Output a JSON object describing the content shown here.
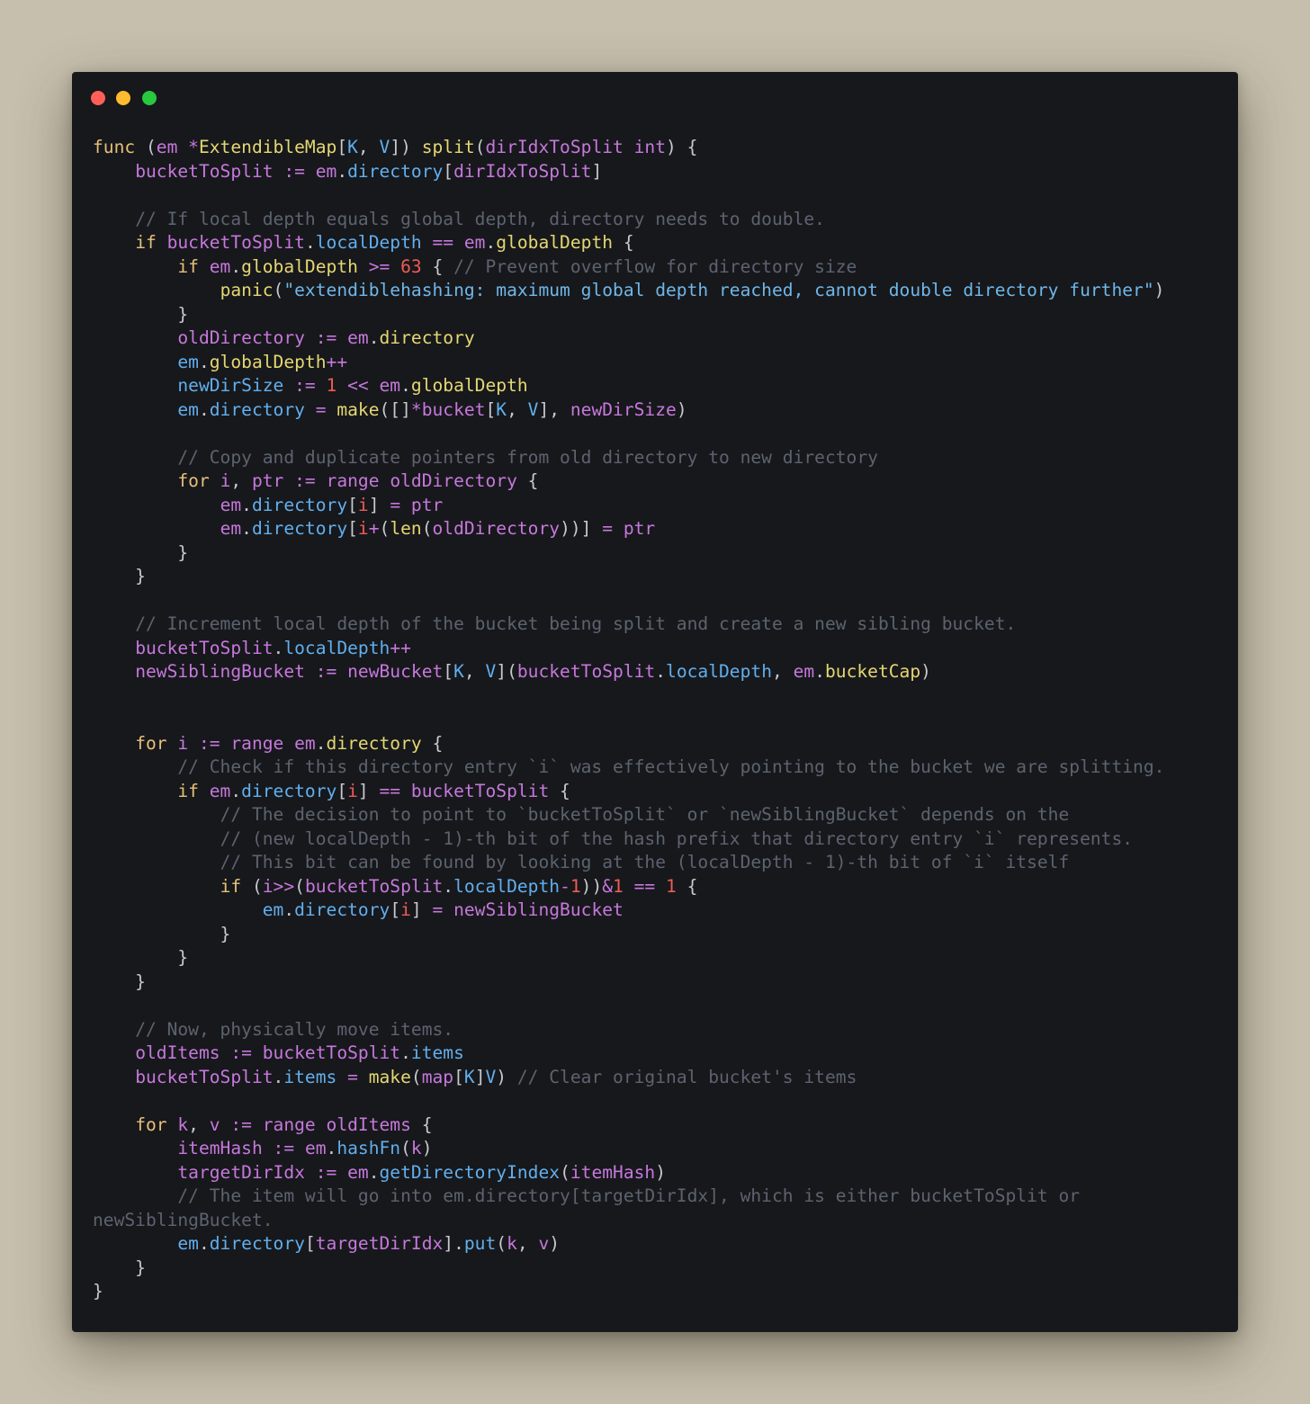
{
  "window": {
    "controls": [
      "close",
      "minimize",
      "zoom"
    ],
    "colors": {
      "background": "#17181b",
      "page": "#c6bfad",
      "close": "#ff5f57",
      "minimize": "#febc2e",
      "zoom": "#28c840"
    }
  },
  "code": {
    "language": "Go",
    "lines": [
      [
        [
          "kw",
          "func"
        ],
        [
          "p",
          " ("
        ],
        [
          "var",
          "em"
        ],
        [
          "p",
          " "
        ],
        [
          "op",
          "*"
        ],
        [
          "fn",
          "ExtendibleMap"
        ],
        [
          "p",
          "["
        ],
        [
          "typ",
          "K"
        ],
        [
          "p",
          ", "
        ],
        [
          "typ",
          "V"
        ],
        [
          "p",
          "]) "
        ],
        [
          "fn",
          "split"
        ],
        [
          "p",
          "("
        ],
        [
          "var",
          "dirIdxToSplit"
        ],
        [
          "p",
          " "
        ],
        [
          "var",
          "int"
        ],
        [
          "p",
          ") {"
        ]
      ],
      [
        [
          "p",
          "    "
        ],
        [
          "var",
          "bucketToSplit"
        ],
        [
          "p",
          " "
        ],
        [
          "op",
          ":="
        ],
        [
          "p",
          " "
        ],
        [
          "var",
          "em"
        ],
        [
          "p",
          "."
        ],
        [
          "field",
          "directory"
        ],
        [
          "p",
          "["
        ],
        [
          "var",
          "dirIdxToSplit"
        ],
        [
          "p",
          "]"
        ]
      ],
      [],
      [
        [
          "p",
          "    "
        ],
        [
          "com",
          "// If local depth equals global depth, directory needs to double."
        ]
      ],
      [
        [
          "p",
          "    "
        ],
        [
          "kw",
          "if"
        ],
        [
          "p",
          " "
        ],
        [
          "var",
          "bucketToSplit"
        ],
        [
          "p",
          "."
        ],
        [
          "field",
          "localDepth"
        ],
        [
          "p",
          " "
        ],
        [
          "op",
          "=="
        ],
        [
          "p",
          " "
        ],
        [
          "var",
          "em"
        ],
        [
          "p",
          "."
        ],
        [
          "fn",
          "globalDepth"
        ],
        [
          "p",
          " {"
        ]
      ],
      [
        [
          "p",
          "        "
        ],
        [
          "kw",
          "if"
        ],
        [
          "p",
          " "
        ],
        [
          "var",
          "em"
        ],
        [
          "p",
          "."
        ],
        [
          "fn",
          "globalDepth"
        ],
        [
          "p",
          " "
        ],
        [
          "op",
          ">="
        ],
        [
          "p",
          " "
        ],
        [
          "num",
          "63"
        ],
        [
          "p",
          " { "
        ],
        [
          "com",
          "// Prevent overflow for directory size"
        ]
      ],
      [
        [
          "p",
          "            "
        ],
        [
          "fn",
          "panic"
        ],
        [
          "p",
          "("
        ],
        [
          "str",
          "\"extendiblehashing: maximum global depth reached, cannot double directory further\""
        ],
        [
          "p",
          ")"
        ]
      ],
      [
        [
          "p",
          "        }"
        ]
      ],
      [
        [
          "p",
          "        "
        ],
        [
          "var",
          "oldDirectory"
        ],
        [
          "p",
          " "
        ],
        [
          "op",
          ":="
        ],
        [
          "p",
          " "
        ],
        [
          "var",
          "em"
        ],
        [
          "p",
          "."
        ],
        [
          "fn",
          "directory"
        ]
      ],
      [
        [
          "p",
          "        "
        ],
        [
          "field",
          "em"
        ],
        [
          "p",
          "."
        ],
        [
          "fn",
          "globalDepth"
        ],
        [
          "op",
          "++"
        ]
      ],
      [
        [
          "p",
          "        "
        ],
        [
          "field",
          "newDirSize"
        ],
        [
          "p",
          " "
        ],
        [
          "op",
          ":="
        ],
        [
          "p",
          " "
        ],
        [
          "num",
          "1"
        ],
        [
          "p",
          " "
        ],
        [
          "op",
          "<<"
        ],
        [
          "p",
          " "
        ],
        [
          "var",
          "em"
        ],
        [
          "p",
          "."
        ],
        [
          "fn",
          "globalDepth"
        ]
      ],
      [
        [
          "p",
          "        "
        ],
        [
          "field",
          "em"
        ],
        [
          "p",
          "."
        ],
        [
          "field",
          "directory"
        ],
        [
          "p",
          " "
        ],
        [
          "op",
          "="
        ],
        [
          "p",
          " "
        ],
        [
          "fn",
          "make"
        ],
        [
          "p",
          "([]"
        ],
        [
          "op",
          "*"
        ],
        [
          "var",
          "bucket"
        ],
        [
          "p",
          "["
        ],
        [
          "typ",
          "K"
        ],
        [
          "p",
          ", "
        ],
        [
          "typ",
          "V"
        ],
        [
          "p",
          "], "
        ],
        [
          "var",
          "newDirSize"
        ],
        [
          "p",
          ")"
        ]
      ],
      [],
      [
        [
          "p",
          "        "
        ],
        [
          "com",
          "// Copy and duplicate pointers from old directory to new directory"
        ]
      ],
      [
        [
          "p",
          "        "
        ],
        [
          "kw",
          "for"
        ],
        [
          "p",
          " "
        ],
        [
          "var",
          "i"
        ],
        [
          "p",
          ", "
        ],
        [
          "var",
          "ptr"
        ],
        [
          "p",
          " "
        ],
        [
          "op",
          ":="
        ],
        [
          "p",
          " "
        ],
        [
          "var",
          "range"
        ],
        [
          "p",
          " "
        ],
        [
          "var",
          "oldDirectory"
        ],
        [
          "p",
          " {"
        ]
      ],
      [
        [
          "p",
          "            "
        ],
        [
          "var",
          "em"
        ],
        [
          "p",
          "."
        ],
        [
          "field",
          "directory"
        ],
        [
          "p",
          "["
        ],
        [
          "num",
          "i"
        ],
        [
          "p",
          "] "
        ],
        [
          "op",
          "="
        ],
        [
          "p",
          " "
        ],
        [
          "var",
          "ptr"
        ]
      ],
      [
        [
          "p",
          "            "
        ],
        [
          "var",
          "em"
        ],
        [
          "p",
          "."
        ],
        [
          "field",
          "directory"
        ],
        [
          "p",
          "["
        ],
        [
          "num",
          "i"
        ],
        [
          "op",
          "+"
        ],
        [
          "p",
          "("
        ],
        [
          "fn",
          "len"
        ],
        [
          "p",
          "("
        ],
        [
          "var",
          "oldDirectory"
        ],
        [
          "p",
          "))] "
        ],
        [
          "op",
          "="
        ],
        [
          "p",
          " "
        ],
        [
          "var",
          "ptr"
        ]
      ],
      [
        [
          "p",
          "        }"
        ]
      ],
      [
        [
          "p",
          "    }"
        ]
      ],
      [],
      [
        [
          "p",
          "    "
        ],
        [
          "com",
          "// Increment local depth of the bucket being split and create a new sibling bucket."
        ]
      ],
      [
        [
          "p",
          "    "
        ],
        [
          "var",
          "bucketToSplit"
        ],
        [
          "p",
          "."
        ],
        [
          "field",
          "localDepth"
        ],
        [
          "op",
          "++"
        ]
      ],
      [
        [
          "p",
          "    "
        ],
        [
          "var",
          "newSiblingBucket"
        ],
        [
          "p",
          " "
        ],
        [
          "op",
          ":="
        ],
        [
          "p",
          " "
        ],
        [
          "var",
          "newBucket"
        ],
        [
          "p",
          "["
        ],
        [
          "typ",
          "K"
        ],
        [
          "p",
          ", "
        ],
        [
          "typ",
          "V"
        ],
        [
          "p",
          "]("
        ],
        [
          "var",
          "bucketToSplit"
        ],
        [
          "p",
          "."
        ],
        [
          "field",
          "localDepth"
        ],
        [
          "p",
          ", "
        ],
        [
          "var",
          "em"
        ],
        [
          "p",
          "."
        ],
        [
          "fn",
          "bucketCap"
        ],
        [
          "p",
          ")"
        ]
      ],
      [],
      [],
      [
        [
          "p",
          "    "
        ],
        [
          "kw",
          "for"
        ],
        [
          "p",
          " "
        ],
        [
          "var",
          "i"
        ],
        [
          "p",
          " "
        ],
        [
          "op",
          ":="
        ],
        [
          "p",
          " "
        ],
        [
          "var",
          "range"
        ],
        [
          "p",
          " "
        ],
        [
          "var",
          "em"
        ],
        [
          "p",
          "."
        ],
        [
          "fn",
          "directory"
        ],
        [
          "p",
          " {"
        ]
      ],
      [
        [
          "p",
          "        "
        ],
        [
          "com",
          "// Check if this directory entry `i` was effectively pointing to the bucket we are splitting."
        ]
      ],
      [
        [
          "p",
          "        "
        ],
        [
          "kw",
          "if"
        ],
        [
          "p",
          " "
        ],
        [
          "var",
          "em"
        ],
        [
          "p",
          "."
        ],
        [
          "field",
          "directory"
        ],
        [
          "p",
          "["
        ],
        [
          "num",
          "i"
        ],
        [
          "p",
          "] "
        ],
        [
          "op",
          "=="
        ],
        [
          "p",
          " "
        ],
        [
          "var",
          "bucketToSplit"
        ],
        [
          "p",
          " {"
        ]
      ],
      [
        [
          "p",
          "            "
        ],
        [
          "com",
          "// The decision to point to `bucketToSplit` or `newSiblingBucket` depends on the"
        ]
      ],
      [
        [
          "p",
          "            "
        ],
        [
          "com",
          "// (new localDepth - 1)-th bit of the hash prefix that directory entry `i` represents."
        ]
      ],
      [
        [
          "p",
          "            "
        ],
        [
          "com",
          "// This bit can be found by looking at the (localDepth - 1)-th bit of `i` itself"
        ]
      ],
      [
        [
          "p",
          "            "
        ],
        [
          "kw",
          "if"
        ],
        [
          "p",
          " ("
        ],
        [
          "var",
          "i"
        ],
        [
          "op",
          ">>"
        ],
        [
          "p",
          "("
        ],
        [
          "var",
          "bucketToSplit"
        ],
        [
          "p",
          "."
        ],
        [
          "field",
          "localDepth"
        ],
        [
          "op",
          "-"
        ],
        [
          "num",
          "1"
        ],
        [
          "p",
          "))"
        ],
        [
          "op",
          "&"
        ],
        [
          "num",
          "1"
        ],
        [
          "p",
          " "
        ],
        [
          "op",
          "=="
        ],
        [
          "p",
          " "
        ],
        [
          "num",
          "1"
        ],
        [
          "p",
          " {"
        ]
      ],
      [
        [
          "p",
          "                "
        ],
        [
          "field",
          "em"
        ],
        [
          "p",
          "."
        ],
        [
          "field",
          "directory"
        ],
        [
          "p",
          "["
        ],
        [
          "num",
          "i"
        ],
        [
          "p",
          "] "
        ],
        [
          "op",
          "="
        ],
        [
          "p",
          " "
        ],
        [
          "var",
          "newSiblingBucket"
        ]
      ],
      [
        [
          "p",
          "            }"
        ]
      ],
      [
        [
          "p",
          "        }"
        ]
      ],
      [
        [
          "p",
          "    }"
        ]
      ],
      [],
      [
        [
          "p",
          "    "
        ],
        [
          "com",
          "// Now, physically move items."
        ]
      ],
      [
        [
          "p",
          "    "
        ],
        [
          "var",
          "oldItems"
        ],
        [
          "p",
          " "
        ],
        [
          "op",
          ":="
        ],
        [
          "p",
          " "
        ],
        [
          "var",
          "bucketToSplit"
        ],
        [
          "p",
          "."
        ],
        [
          "field",
          "items"
        ]
      ],
      [
        [
          "p",
          "    "
        ],
        [
          "var",
          "bucketToSplit"
        ],
        [
          "p",
          "."
        ],
        [
          "field",
          "items"
        ],
        [
          "p",
          " "
        ],
        [
          "op",
          "="
        ],
        [
          "p",
          " "
        ],
        [
          "fn",
          "make"
        ],
        [
          "p",
          "("
        ],
        [
          "var",
          "map"
        ],
        [
          "p",
          "["
        ],
        [
          "typ",
          "K"
        ],
        [
          "p",
          "]"
        ],
        [
          "typ",
          "V"
        ],
        [
          "p",
          ") "
        ],
        [
          "com",
          "// Clear original bucket's items"
        ]
      ],
      [],
      [
        [
          "p",
          "    "
        ],
        [
          "kw",
          "for"
        ],
        [
          "p",
          " "
        ],
        [
          "var",
          "k"
        ],
        [
          "p",
          ", "
        ],
        [
          "var",
          "v"
        ],
        [
          "p",
          " "
        ],
        [
          "op",
          ":="
        ],
        [
          "p",
          " "
        ],
        [
          "var",
          "range"
        ],
        [
          "p",
          " "
        ],
        [
          "var",
          "oldItems"
        ],
        [
          "p",
          " {"
        ]
      ],
      [
        [
          "p",
          "        "
        ],
        [
          "var",
          "itemHash"
        ],
        [
          "p",
          " "
        ],
        [
          "op",
          ":="
        ],
        [
          "p",
          " "
        ],
        [
          "var",
          "em"
        ],
        [
          "p",
          "."
        ],
        [
          "field",
          "hashFn"
        ],
        [
          "p",
          "("
        ],
        [
          "var",
          "k"
        ],
        [
          "p",
          ")"
        ]
      ],
      [
        [
          "p",
          "        "
        ],
        [
          "var",
          "targetDirIdx"
        ],
        [
          "p",
          " "
        ],
        [
          "op",
          ":="
        ],
        [
          "p",
          " "
        ],
        [
          "var",
          "em"
        ],
        [
          "p",
          "."
        ],
        [
          "field",
          "getDirectoryIndex"
        ],
        [
          "p",
          "("
        ],
        [
          "var",
          "itemHash"
        ],
        [
          "p",
          ")"
        ]
      ],
      [
        [
          "p",
          "        "
        ],
        [
          "com",
          "// The item will go into em.directory[targetDirIdx], which is either bucketToSplit or"
        ]
      ],
      [
        [
          "com",
          "newSiblingBucket."
        ]
      ],
      [
        [
          "p",
          "        "
        ],
        [
          "field",
          "em"
        ],
        [
          "p",
          "."
        ],
        [
          "field",
          "directory"
        ],
        [
          "p",
          "["
        ],
        [
          "var",
          "targetDirIdx"
        ],
        [
          "p",
          "]."
        ],
        [
          "field",
          "put"
        ],
        [
          "p",
          "("
        ],
        [
          "var",
          "k"
        ],
        [
          "p",
          ", "
        ],
        [
          "var",
          "v"
        ],
        [
          "p",
          ")"
        ]
      ],
      [
        [
          "p",
          "    }"
        ]
      ],
      [
        [
          "p",
          "}"
        ]
      ]
    ]
  }
}
